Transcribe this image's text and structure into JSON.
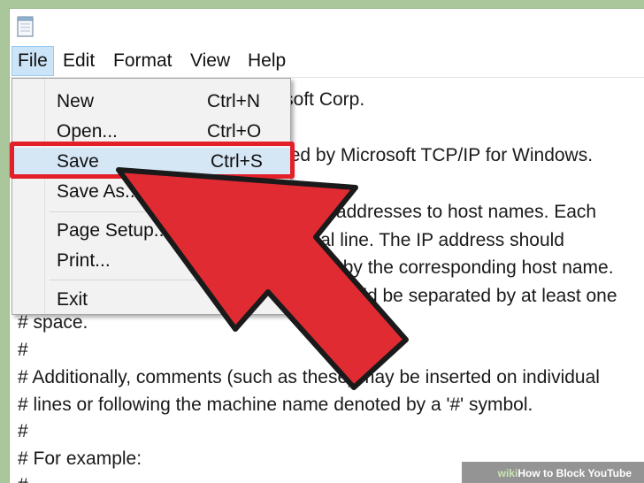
{
  "menubar": {
    "items": [
      "File",
      "Edit",
      "Format",
      "View",
      "Help"
    ]
  },
  "file_menu": {
    "items": [
      {
        "label": "New",
        "shortcut": "Ctrl+N"
      },
      {
        "label": "Open...",
        "shortcut": "Ctrl+O"
      },
      {
        "label": "Save",
        "shortcut": "Ctrl+S"
      },
      {
        "label": "Save As...",
        "shortcut": ""
      },
      {
        "label": "Page Setup...",
        "shortcut": ""
      },
      {
        "label": "Print...",
        "shortcut": ""
      },
      {
        "label": "Exit",
        "shortcut": ""
      }
    ]
  },
  "editor": {
    "lines": [
      "# Copyright (c) 1993-2009 Microsoft Corp.",
      "#",
      "# This is a sample HOSTS file used by Microsoft TCP/IP for Windows.",
      "#",
      "# This file contains the mappings of IP addresses to host names. Each",
      "# entry should be kept on an individual line. The IP address should",
      "# be placed in the first column followed by the corresponding host name.",
      "# The IP address and the host name should be separated by at least one",
      "# space.",
      "#",
      "# Additionally, comments (such as these) may be inserted on individual",
      "# lines or following the machine name denoted by a '#' symbol.",
      "#",
      "# For example:",
      "#"
    ]
  },
  "watermark": {
    "prefix": "wiki",
    "title": "How to Block YouTube"
  },
  "colors": {
    "background": "#a9c79a",
    "highlight_box": "#e3202a",
    "arrow_fill": "#e02b33",
    "arrow_stroke": "#1a1a1a",
    "menu_highlight": "#d5e6f5"
  },
  "icons": [
    "notepad-icon",
    "red-arrow-annotation"
  ]
}
